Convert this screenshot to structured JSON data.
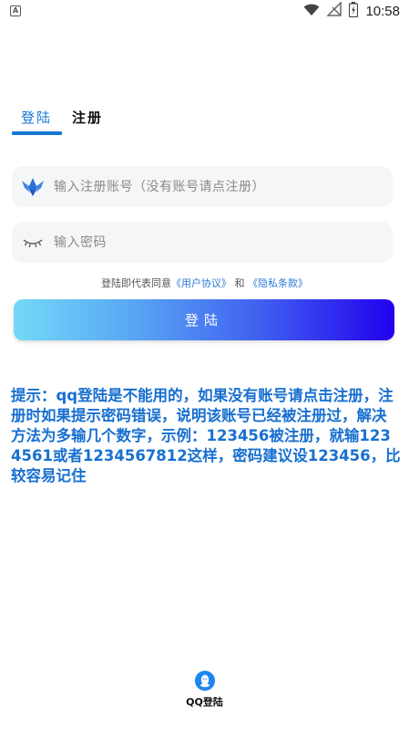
{
  "status_bar": {
    "app_badge": "A",
    "time": "10:58",
    "icons": [
      "wifi-icon",
      "signal-off-icon",
      "battery-charging-icon"
    ]
  },
  "tabs": [
    {
      "label": "登陆",
      "active": true
    },
    {
      "label": "注册",
      "active": false
    }
  ],
  "form": {
    "account_placeholder": "输入注册账号（没有账号请点注册）",
    "account_value": "",
    "account_icon": "crown-wings-icon",
    "password_placeholder": "输入密码",
    "password_value": "",
    "password_icon": "eye-closed-icon"
  },
  "agreement": {
    "prefix": "登陆即代表同意",
    "user_agreement": "《用户协议》",
    "and": "和",
    "privacy_policy": "《隐私条款》"
  },
  "login_button_label": "登陆",
  "tip_text": "提示：qq登陆是不能用的，如果没有账号请点击注册，注册时如果提示密码错误，说明该账号已经被注册过，解决方法为多输几个数字，示例：123456被注册，就输1234561或者1234567812这样，密码建议设123456，比较容易记住",
  "qq_login_label": "QQ登陆",
  "colors": {
    "accent": "#1677d6",
    "tip": "#1870d0",
    "gradient_start": "#73d9f7",
    "gradient_end": "#2200ee"
  }
}
